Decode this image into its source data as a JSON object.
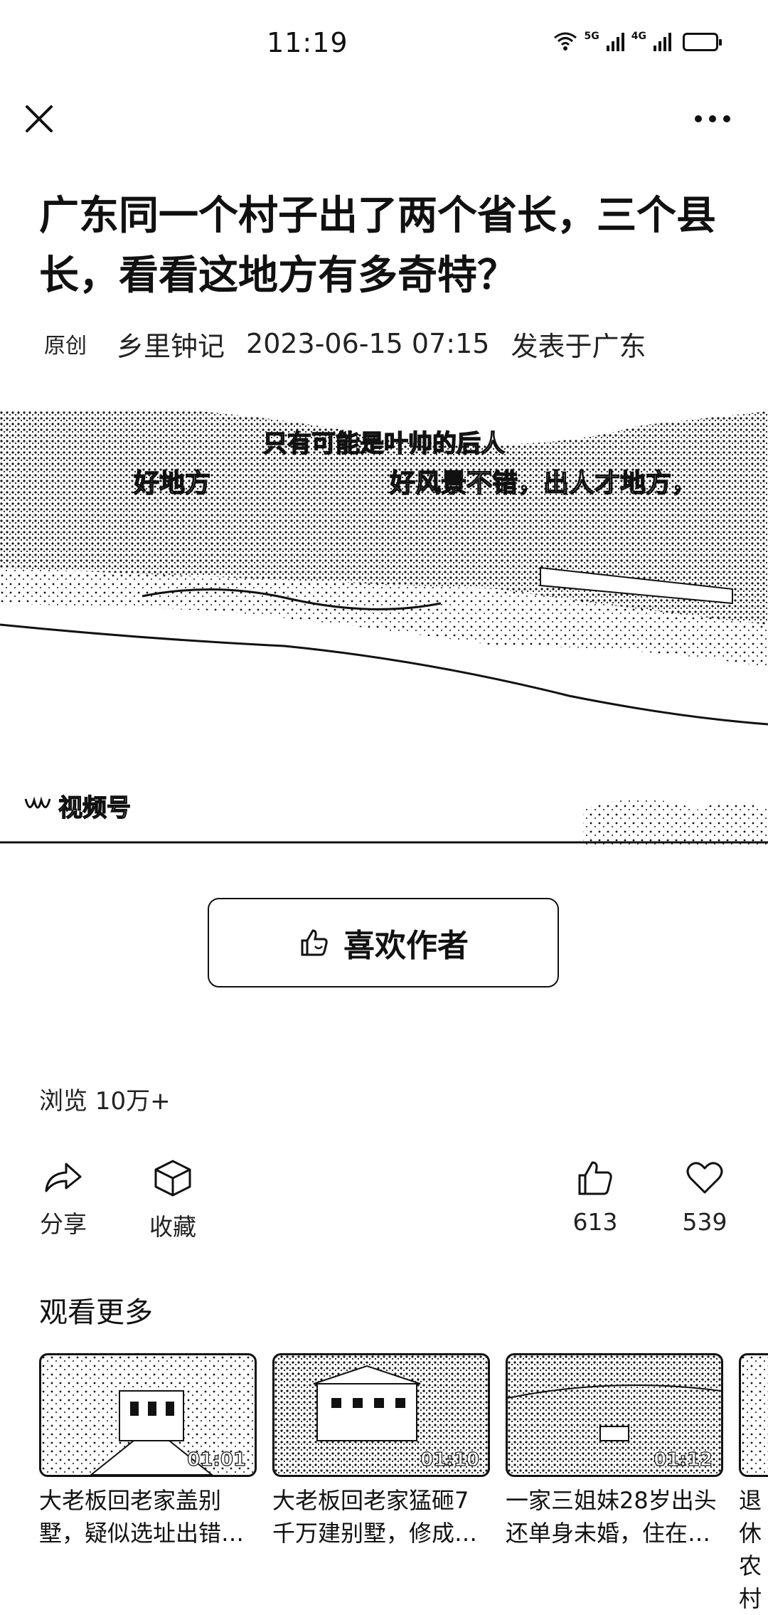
{
  "status_bar": {
    "time": "11:19",
    "signal_1_label": "5G",
    "signal_2_label": "4G",
    "icons": [
      "wifi-icon",
      "signal-icon",
      "signal-icon",
      "battery-icon"
    ]
  },
  "nav": {
    "close_icon": "close-icon",
    "more_icon": "more-dots-icon"
  },
  "article": {
    "title": "广东同一个村子出了两个省长，三个县长，看看这地方有多奇特？",
    "badge": "原创",
    "author": "乡里钟记",
    "datetime": "2023-06-15 07:15",
    "location": "发表于广东"
  },
  "video": {
    "subtitle_top": "只有可能是叶帅的后人",
    "subtitle_left": "好地方",
    "subtitle_right": "好风景不错，出人才地方，",
    "channel_label": "视频号"
  },
  "like_author": {
    "label": "喜欢作者",
    "icon": "thumb-up-icon"
  },
  "stats": {
    "views": "浏览 10万+"
  },
  "actions": {
    "share": "分享",
    "collect": "收藏",
    "like_count": "613",
    "favorite_count": "539"
  },
  "more": {
    "header": "观看更多",
    "cards": [
      {
        "title": "大老板回老家盖别墅，疑似选址出错…",
        "duration": "01:01"
      },
      {
        "title": "大老板回老家猛砸7千万建别墅，修成…",
        "duration": "01:10"
      },
      {
        "title": "一家三姐妹28岁出头还单身未婚，住在…",
        "duration": "01:12"
      },
      {
        "title": "退休农村",
        "duration": ""
      }
    ]
  },
  "colors": {
    "text": "#111111",
    "background": "#ffffff"
  }
}
